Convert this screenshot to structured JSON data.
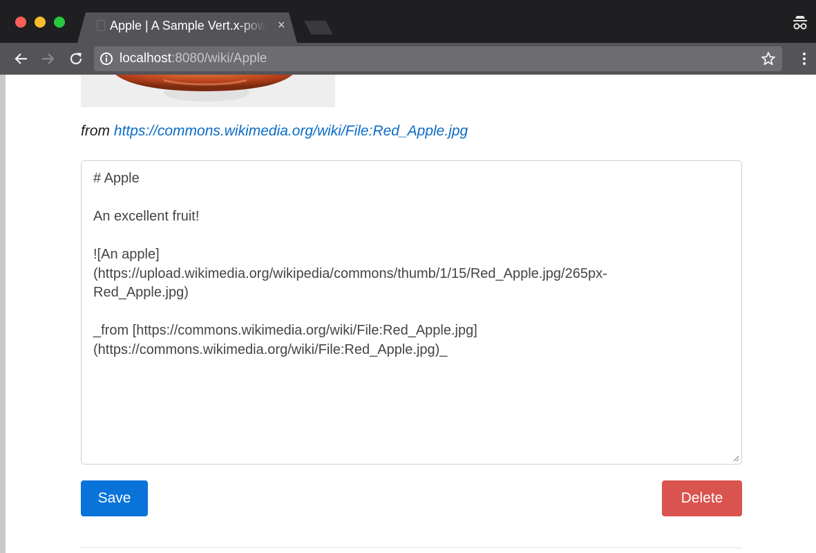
{
  "browser": {
    "tab_title": "Apple | A Sample Vert.x-powered Wiki",
    "tab_close": "×",
    "url_host": "localhost",
    "url_rest": ":8080/wiki/Apple",
    "icons": [
      "back-arrow-icon",
      "forward-arrow-icon",
      "reload-icon",
      "info-icon",
      "star-icon",
      "menu-dots-icon",
      "incognito-icon"
    ]
  },
  "page": {
    "image_alt": "An apple",
    "from_prefix": "from ",
    "from_link": "https://commons.wikimedia.org/wiki/File:Red_Apple.jpg",
    "editor_text": "# Apple\n\nAn excellent fruit!\n\n![An apple]\n(https://upload.wikimedia.org/wikipedia/commons/thumb/1/15/Red_Apple.jpg/265px-\nRed_Apple.jpg)\n\n_from [https://commons.wikimedia.org/wiki/File:Red_Apple.jpg]\n(https://commons.wikimedia.org/wiki/File:Red_Apple.jpg)_",
    "save_label": "Save",
    "delete_label": "Delete"
  },
  "colors": {
    "primary": "#0a73da",
    "danger": "#d9534f",
    "link": "#0a6bc5"
  }
}
